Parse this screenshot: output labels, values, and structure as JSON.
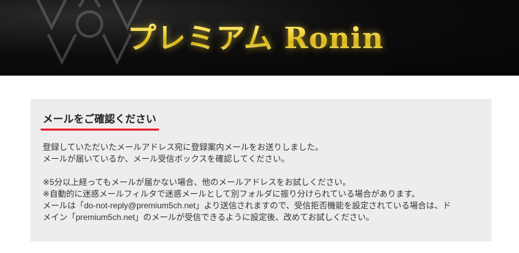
{
  "header": {
    "logo_text": "プレミアム Ronin"
  },
  "notice": {
    "title": "メールをご確認ください",
    "paragraph1": [
      "登録していただいたメールアドレス宛に登録案内メールをお送りしました。",
      "メールが届いているか、メール受信ボックスを確認してください。"
    ],
    "paragraph2": [
      "※5分以上経ってもメールが届かない場合、他のメールアドレスをお試しください。",
      "※自動的に迷惑メールフィルタで迷惑メールとして別フォルダに振り分けられている場合があります。",
      "メールは「do-not-reply@premium5ch.net」より送信されますので、受信拒否機能を設定されている場合は、ド",
      "メイン「premium5ch.net」のメールが受信できるように設定後、改めてお試しください。"
    ],
    "colors": {
      "panel_background": "#ededed",
      "title_underline": "#e8222d",
      "header_background": "#050505",
      "logo_gold": "#f7e25a"
    }
  }
}
